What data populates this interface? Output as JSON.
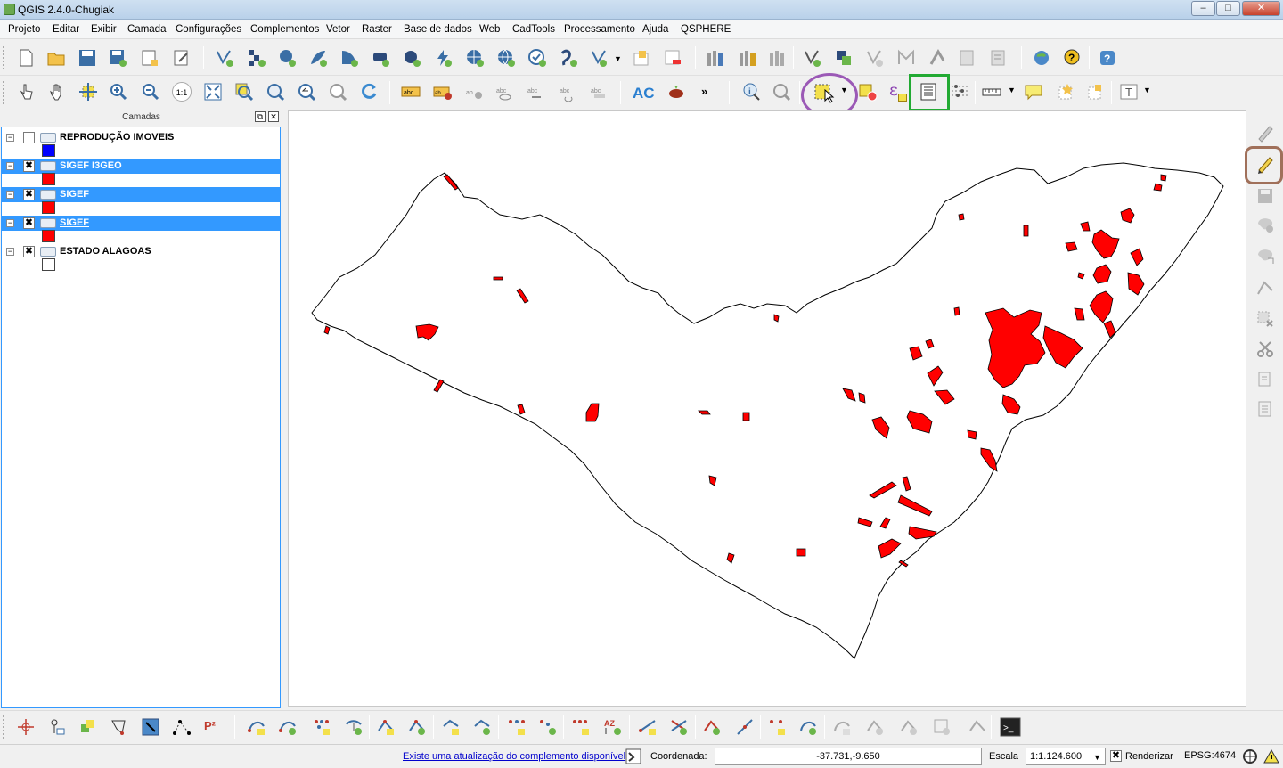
{
  "window": {
    "title": "QGIS 2.4.0-Chugiak",
    "controls": {
      "minimize": "–",
      "maximize": "□",
      "close": "✕"
    }
  },
  "menu": [
    "Projeto",
    "Editar",
    "Exibir",
    "Camada",
    "Configurações",
    "Complementos",
    "Vetor",
    "Raster",
    "Base de dados",
    "Web",
    "CadTools",
    "Processamento",
    "Ajuda",
    "QSPHERE"
  ],
  "layers_panel": {
    "title": "Camadas",
    "layers": [
      {
        "name": "REPRODUÇÃO IMOVEIS",
        "checked": "",
        "selected": false,
        "color": "#0000ff"
      },
      {
        "name": "SIGEF I3GEO",
        "checked": "✖",
        "selected": true,
        "color": "#ff0000"
      },
      {
        "name": "SIGEF",
        "checked": "✖",
        "selected": true,
        "color": "#ff0000"
      },
      {
        "name": "SIGEF",
        "checked": "✖",
        "selected": true,
        "color": "#ff0000"
      },
      {
        "name": "ESTADO ALAGOAS",
        "checked": "✖",
        "selected": false,
        "color": "#ffffff"
      }
    ]
  },
  "toolbar_labels": {
    "ac": "AC",
    "more": "»",
    "p2": "P²",
    "plotcomp": "1:1"
  },
  "status": {
    "update_link": "Existe uma atualização do complemento disponível",
    "coord_label": "Coordenada:",
    "coord_value": "-37.731,-9.650",
    "scale_label": "Escala",
    "scale_value": "1:1.124.600",
    "render_label": "Renderizar",
    "render_checked": "✖",
    "crs": "EPSG:4674"
  },
  "colors": {
    "parcel_fill": "#ff0000",
    "selection_blue": "#3399ff",
    "highlight_purple": "#9b59b6",
    "highlight_green": "#22aa33",
    "highlight_brown": "#a0705a"
  }
}
